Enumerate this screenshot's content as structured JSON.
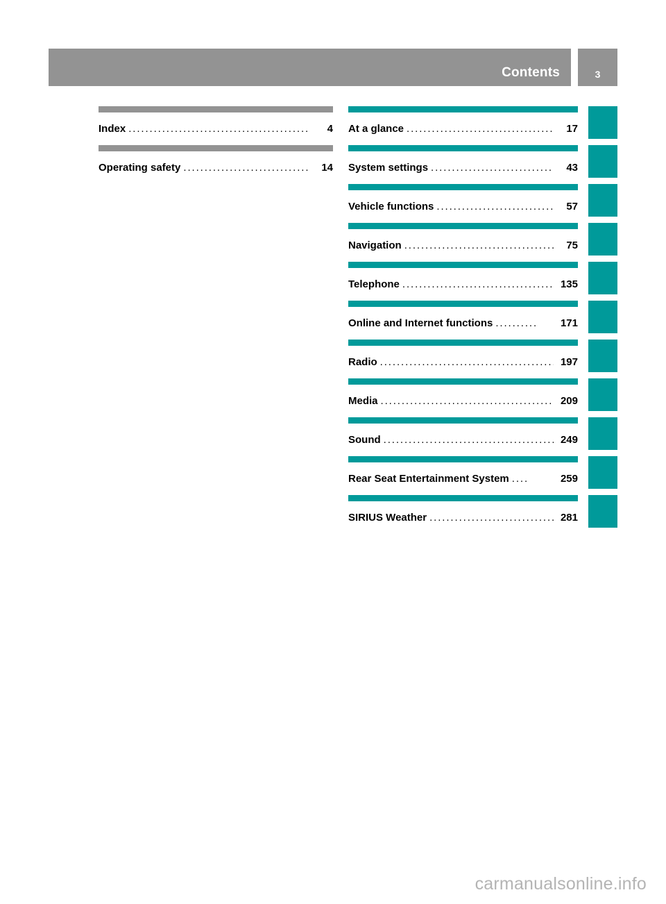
{
  "header": {
    "title": "Contents",
    "page_number": "3",
    "bar_color": "#939393"
  },
  "colors": {
    "gray_rule": "#939393",
    "teal_rule": "#009a9a",
    "text": "#000000",
    "watermark": "#b4b4b4"
  },
  "toc": {
    "left_column": [
      {
        "title": "Index",
        "page": "4",
        "leader": ".......................................................",
        "rule_color": "#939393"
      },
      {
        "title": "Operating safety",
        "page": "14",
        "leader": "..................................",
        "rule_color": "#939393"
      }
    ],
    "right_column": [
      {
        "title": "At a glance",
        "page": "17",
        "leader": "...........................................",
        "rule_color": "#009a9a"
      },
      {
        "title": "System settings",
        "page": "43",
        "leader": "...................................",
        "rule_color": "#009a9a"
      },
      {
        "title": "Vehicle functions",
        "page": "57",
        "leader": "................................",
        "rule_color": "#009a9a"
      },
      {
        "title": "Navigation",
        "page": "75",
        "leader": "............................................",
        "rule_color": "#009a9a"
      },
      {
        "title": "Telephone",
        "page": "135",
        "leader": ".........................................",
        "rule_color": "#009a9a"
      },
      {
        "title": "Online and Internet functions",
        "page": "171",
        "leader": "..........",
        "rule_color": "#009a9a"
      },
      {
        "title": "Radio",
        "page": "197",
        "leader": "..................................................",
        "rule_color": "#009a9a"
      },
      {
        "title": "Media",
        "page": "209",
        "leader": ".................................................",
        "rule_color": "#009a9a"
      },
      {
        "title": "Sound",
        "page": "249",
        "leader": ".................................................",
        "rule_color": "#009a9a"
      },
      {
        "title": "Rear Seat Entertainment System",
        "page": "259",
        "leader": "....",
        "rule_color": "#009a9a"
      },
      {
        "title": "SIRIUS Weather",
        "page": "281",
        "leader": "................................",
        "rule_color": "#009a9a"
      }
    ]
  },
  "thumb_tabs": [
    {
      "label": ""
    },
    {
      "label": ""
    },
    {
      "label": ""
    },
    {
      "label": ""
    },
    {
      "label": ""
    },
    {
      "label": ""
    },
    {
      "label": ""
    },
    {
      "label": ""
    },
    {
      "label": ""
    },
    {
      "label": ""
    },
    {
      "label": ""
    }
  ],
  "watermark": {
    "text": "carmanualsonline.info"
  }
}
